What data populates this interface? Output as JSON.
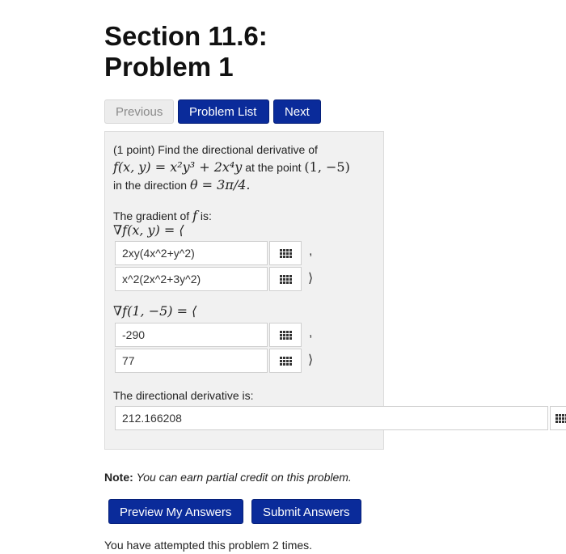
{
  "header": {
    "title_line1": "Section 11.6:",
    "title_line2": "Problem 1"
  },
  "nav": {
    "previous": "Previous",
    "problem_list": "Problem List",
    "next": "Next"
  },
  "problem": {
    "points": "(1 point) Find the directional derivative of",
    "function": "f(x, y) = x²y³ + 2x⁴y",
    "at_the_point": "at the point",
    "point": "(1, −5)",
    "in_the_direction": "in the direction",
    "theta": "θ = 3π/4.",
    "gradient_label": "The gradient of",
    "gradient_f": "f",
    "gradient_is": "is:",
    "grad_fxy": "∇f(x, y) = ⟨",
    "grad_at_point": "∇f(1, −5) = ⟨",
    "directional_label": "The directional derivative is:"
  },
  "answers": {
    "grad_x": "2xy(4x^2+y^2)",
    "grad_y": "x^2(2x^2+3y^2)",
    "grad_point_x": "-290",
    "grad_point_y": "77",
    "directional": "212.166208"
  },
  "separators": {
    "comma": ",",
    "close": "⟩"
  },
  "note": {
    "label": "Note:",
    "text": "You can earn partial credit on this problem."
  },
  "actions": {
    "preview": "Preview My Answers",
    "submit": "Submit Answers"
  },
  "status": "You have attempted this problem 2 times.",
  "icons": {
    "keyboard": "keyboard-grid-icon"
  },
  "colors": {
    "primary": "#0a2b9a",
    "panel_bg": "#f1f1f1"
  }
}
